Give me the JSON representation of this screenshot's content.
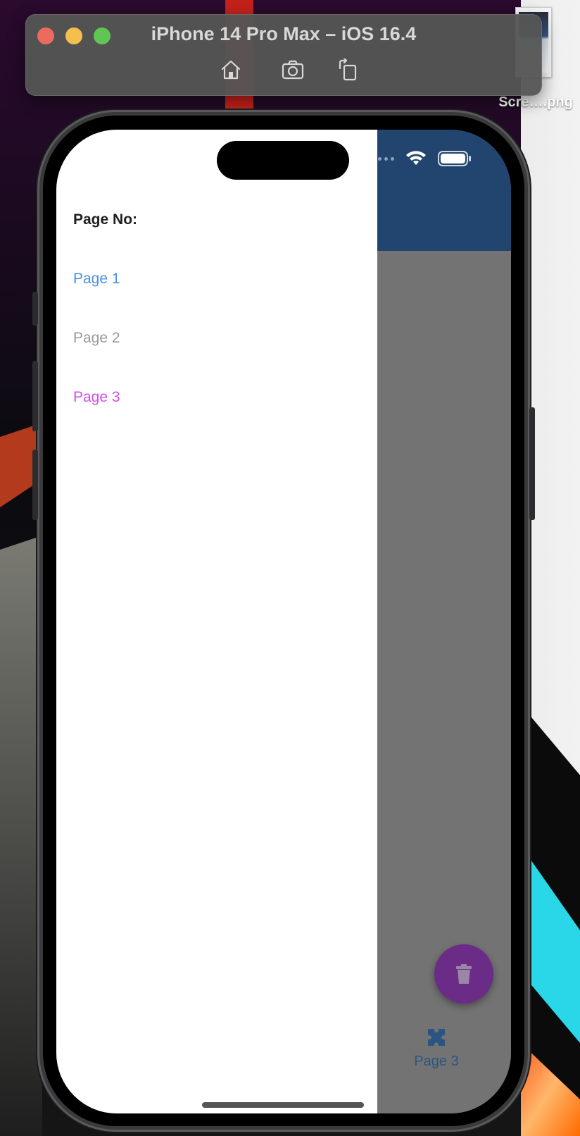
{
  "simulator": {
    "title": "iPhone 14 Pro Max – iOS 16.4",
    "toolbar": {
      "home_icon": "home-icon",
      "screenshot_icon": "camera-icon",
      "rotate_icon": "rotate-icon"
    }
  },
  "desktop": {
    "file_label": "Scre….png"
  },
  "app": {
    "drawer": {
      "header": "Page No:",
      "items": [
        {
          "label": "Page 1",
          "color": "#4a90e2"
        },
        {
          "label": "Page 2",
          "color": "#9a9a9a"
        },
        {
          "label": "Page 3",
          "color": "#d54be6"
        }
      ]
    },
    "app_bar_color": "#21456e",
    "fab": {
      "icon": "trash-icon",
      "color": "#6a2c86"
    },
    "bottom_nav": {
      "label": "Page 3",
      "icon": "puzzle-icon"
    }
  }
}
